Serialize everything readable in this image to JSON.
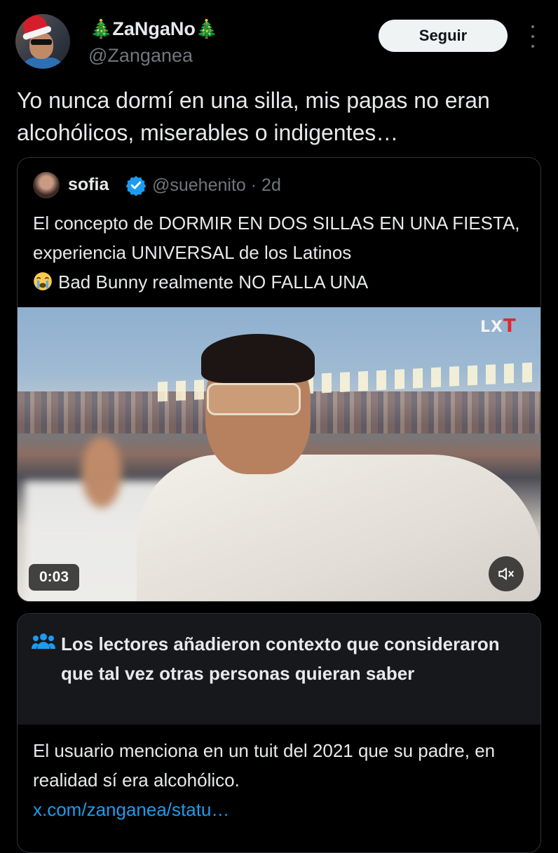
{
  "tweet": {
    "display_name": "ZaNgaNo",
    "name_emoji": "🎄",
    "handle": "@Zanganea",
    "follow_label": "Seguir",
    "text": "Yo nunca dormí en una silla, mis papas no eran alcohólicos, miserables o indigentes…"
  },
  "quote": {
    "name": "sofia",
    "handle": "@suehenito",
    "separator": "·",
    "age": "2d",
    "text_line1": "El concepto de DORMIR EN DOS SILLAS EN UNA FIESTA, experiencia UNIVERSAL de los Latinos",
    "text_line2": "Bad Bunny realmente NO FALLA UNA",
    "video": {
      "duration": "0:03",
      "brand_small": "LX",
      "brand_letter": "T"
    }
  },
  "community_note": {
    "title": "Los lectores añadieron contexto que consideraron que tal vez otras personas quieran saber",
    "body": "El usuario menciona en un tuit del 2021 que su padre, en realidad sí era alcohólico.",
    "link": "x.com/zanganea/statu…"
  },
  "colors": {
    "background": "#000000",
    "text": "#e7e9ea",
    "secondary": "#71767b",
    "link": "#1d9bf0",
    "verified": "#1d9bf0"
  },
  "icons": [
    "more-icon",
    "verified-icon",
    "crying-face-icon",
    "mute-icon",
    "community-notes-icon"
  ]
}
